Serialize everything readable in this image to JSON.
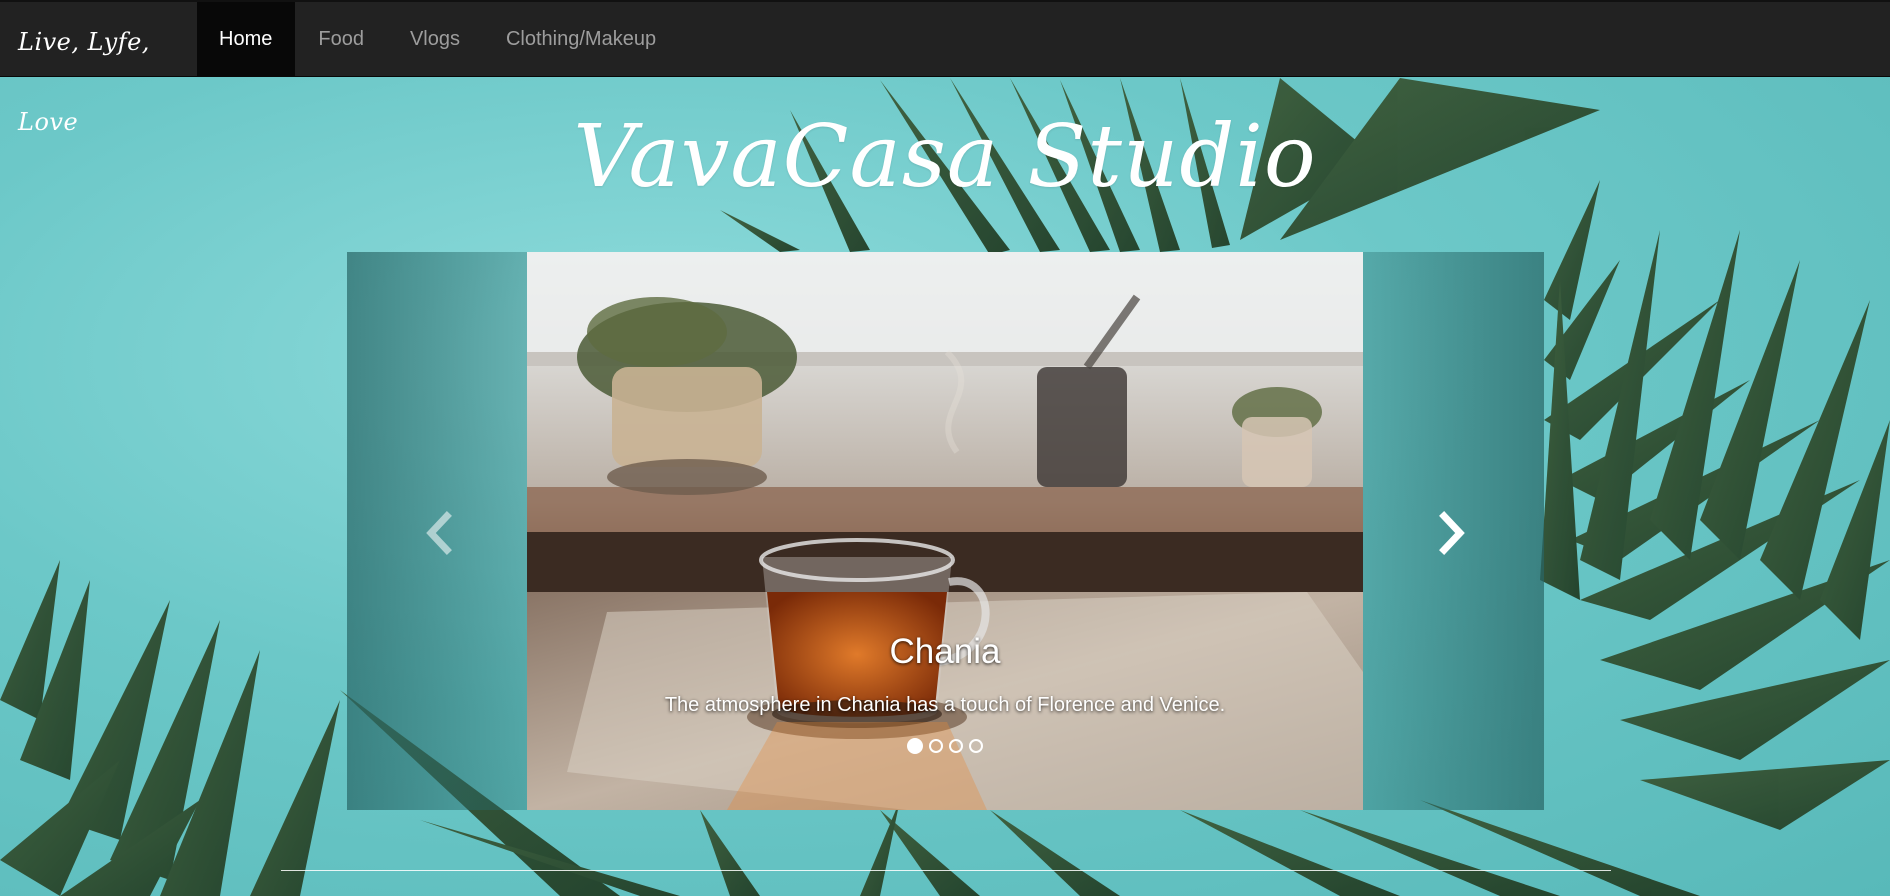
{
  "navbar": {
    "brand": "Live, Lyfe, Love",
    "items": [
      {
        "label": "Home",
        "active": true
      },
      {
        "label": "Food",
        "active": false
      },
      {
        "label": "Vlogs",
        "active": false
      },
      {
        "label": "Clothing/Makeup",
        "active": false
      }
    ]
  },
  "hero": {
    "title": "VavaCasa Studio"
  },
  "carousel": {
    "caption_title": "Chania",
    "caption_text": "The atmosphere in Chania has a touch of Florence and Venice.",
    "active_index": 0,
    "slide_count": 4,
    "prev_icon": "chevron-left-icon",
    "next_icon": "chevron-right-icon"
  },
  "colors": {
    "navbar_bg": "#222222",
    "nav_active_bg": "#080808",
    "nav_text": "#9d9d9d",
    "background": "#6cc9c9"
  }
}
